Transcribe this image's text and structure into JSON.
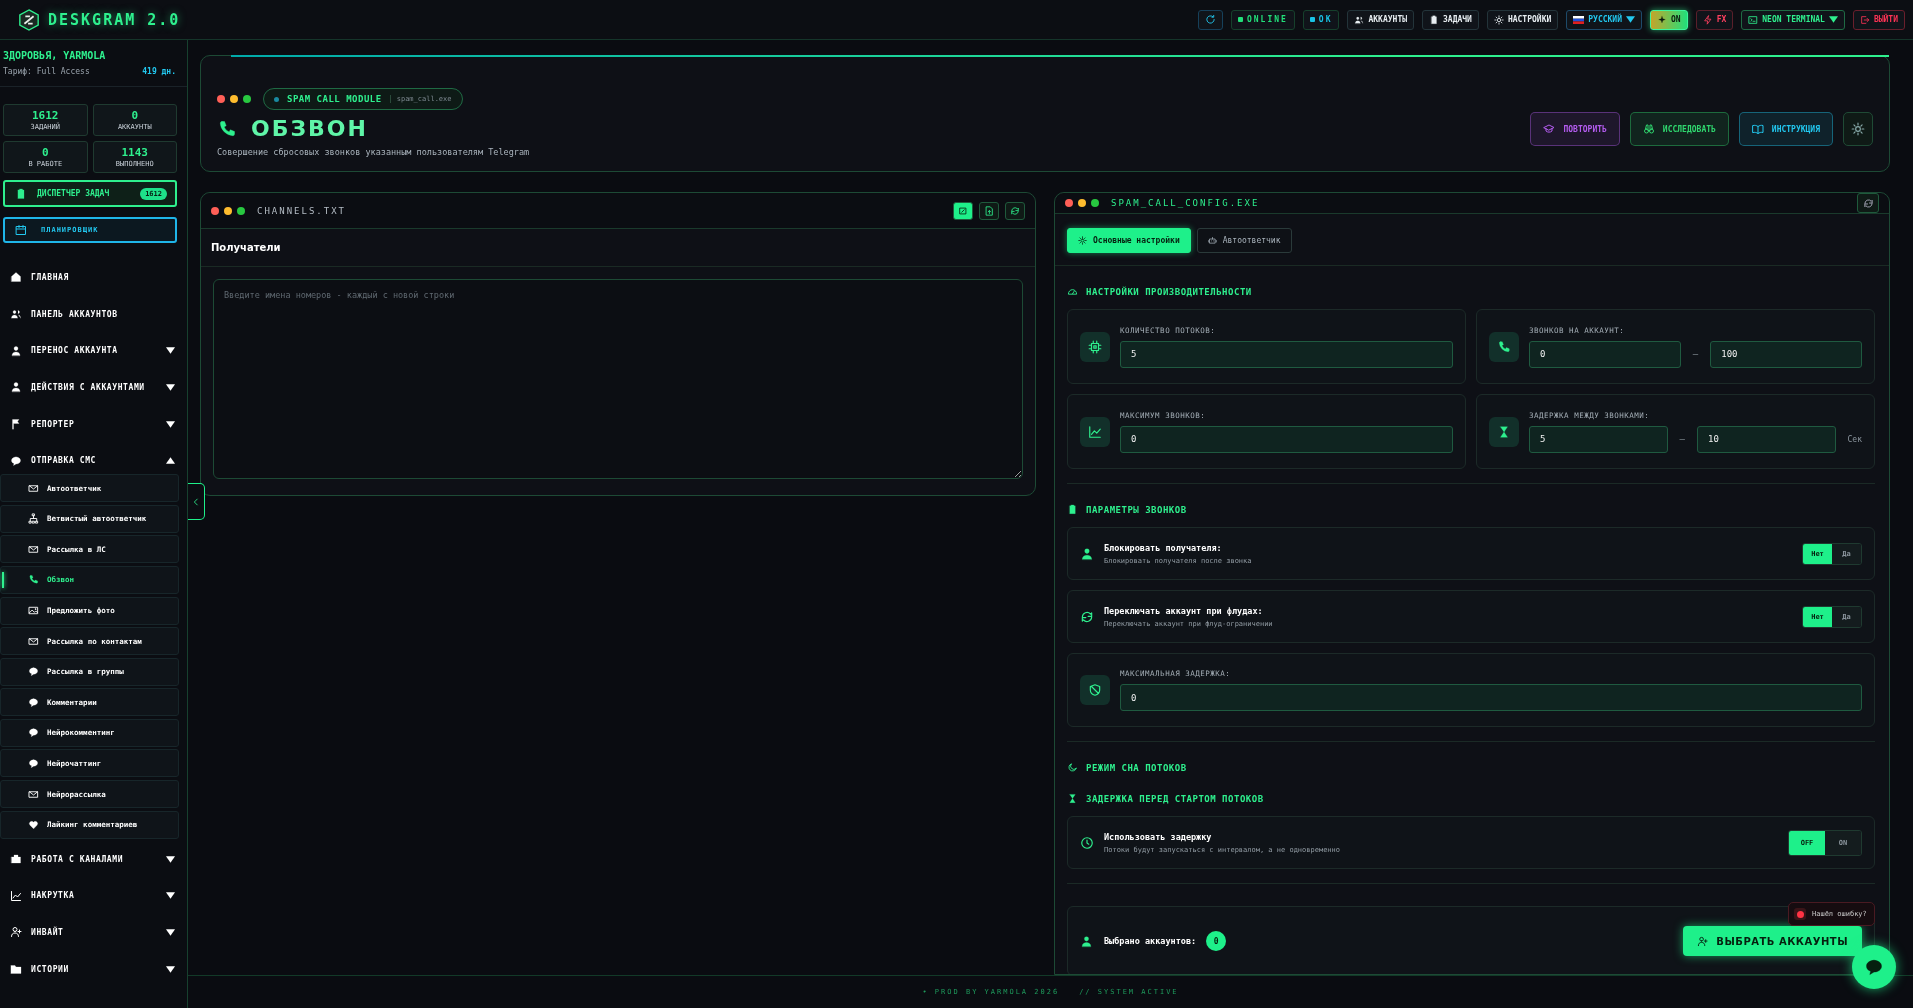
{
  "app": {
    "title": "DESKGRAM 2.0"
  },
  "topbar": {
    "items": [
      {
        "kind": "icon"
      },
      {
        "kind": "status",
        "label": "ONLINE",
        "color": "#22e07a"
      },
      {
        "kind": "status",
        "label": "OK",
        "color": "#19c3e6"
      },
      {
        "kind": "nav",
        "label": "АККАУНТЫ"
      },
      {
        "kind": "nav",
        "label": "ЗАДАЧИ"
      },
      {
        "kind": "nav",
        "label": "НАСТРОЙКИ"
      },
      {
        "kind": "select",
        "label": "РУССКИЙ"
      },
      {
        "kind": "toggle",
        "label": "ON"
      },
      {
        "kind": "effect",
        "label": "FX"
      },
      {
        "kind": "theme",
        "label": "NEON TERMINAL"
      },
      {
        "kind": "exit",
        "label": "ВЫЙТИ"
      }
    ]
  },
  "sidebar": {
    "greeting": "ЗДОРОВЬЯ, YARMOLA",
    "plan": "Тариф: Full Access",
    "days": "419 дн.",
    "stats": [
      {
        "value": "1612",
        "label": "ЗАДАНИЙ"
      },
      {
        "value": "0",
        "label": "АККАУНТЫ"
      },
      {
        "value": "0",
        "label": "В РАБОТЕ"
      },
      {
        "value": "1143",
        "label": "ВЫПОЛНЕНО"
      }
    ],
    "dispatcher": {
      "label": "ДИСПЕТЧЕР ЗАДАЧ",
      "badge": "1612"
    },
    "planner": {
      "label": "ПЛАНИРОВЩИК"
    },
    "items": [
      {
        "kind": "link",
        "label": "ГЛАВНАЯ"
      },
      {
        "kind": "link",
        "label": "ПАНЕЛЬ АККАУНТОВ"
      },
      {
        "kind": "group",
        "label": "ПЕРЕНОС АККАУНТА",
        "expanded": false
      },
      {
        "kind": "group",
        "label": "ДЕЙСТВИЯ С АККАУНТАМИ",
        "expanded": false
      },
      {
        "kind": "group",
        "label": "РЕПОРТЕР",
        "expanded": false
      },
      {
        "kind": "group",
        "label": "ОТПРАВКА СМС",
        "expanded": true,
        "children": [
          {
            "label": "Автоответчик",
            "selected": false
          },
          {
            "label": "Ветвистый автоответчик",
            "selected": false
          },
          {
            "label": "Рассылка в ЛС",
            "selected": false
          },
          {
            "label": "Обзвон",
            "selected": true
          },
          {
            "label": "Предложить фото",
            "selected": false
          },
          {
            "label": "Рассылка по контактам",
            "selected": false
          },
          {
            "label": "Рассылка в группы",
            "selected": false
          },
          {
            "label": "Комментарии",
            "selected": false
          },
          {
            "label": "Нейрокомментинг",
            "selected": false
          },
          {
            "label": "Нейрочаттинг",
            "selected": false
          },
          {
            "label": "Нейрорассылка",
            "selected": false
          },
          {
            "label": "Лайкинг комментариев",
            "selected": false
          }
        ]
      },
      {
        "kind": "group",
        "label": "РАБОТА С КАНАЛАМИ",
        "expanded": false
      },
      {
        "kind": "group",
        "label": "НАКРУТКА",
        "expanded": false
      },
      {
        "kind": "group",
        "label": "ИНВАЙТ",
        "expanded": false
      },
      {
        "kind": "group",
        "label": "ИСТОРИИ",
        "expanded": false
      }
    ]
  },
  "header": {
    "module": "SPAM CALL MODULE",
    "file": "spam_call.exe",
    "title": "ОБЗВОН",
    "subtitle": "Совершение сбросовых звонков указанным пользователям Telegram",
    "buttons": [
      {
        "label": "ПОВТОРИТЬ",
        "color": "#b45cf0"
      },
      {
        "label": "ИССЛЕДОВАТЬ",
        "color": "#2fd66e"
      },
      {
        "label": "ИНСТРУКЦИЯ",
        "color": "#22c8f0"
      }
    ]
  },
  "channels": {
    "title": "CHANNELS.TXT",
    "tools": [
      {
        "selected": true
      },
      {
        "selected": false
      },
      {
        "selected": false
      }
    ],
    "section": "Получатели",
    "placeholder": "Введите имена номеров - каждый с новой строки"
  },
  "config": {
    "title": "SPAM_CALL_CONFIG.EXE",
    "tabs": [
      {
        "label": "Основные настройки",
        "selected": true
      },
      {
        "label": "Автоответчик",
        "selected": false
      }
    ],
    "blocks": [
      {
        "kind": "heading",
        "label": "НАСТРОЙКИ ПРОИЗВОДИТЕЛЬНОСТИ"
      },
      {
        "kind": "fields",
        "fields": [
          {
            "label": "КОЛИЧЕСТВО ПОТОКОВ:",
            "values": [
              "5"
            ]
          },
          {
            "label": "ЗВОНКОВ НА АККАУНТ:",
            "values": [
              "0",
              "100"
            ],
            "separator": "—"
          },
          {
            "label": "МАКСИМУМ ЗВОНКОВ:",
            "values": [
              "0"
            ]
          },
          {
            "label": "ЗАДЕРЖКА МЕЖДУ ЗВОНКАМИ:",
            "values": [
              "5",
              "10"
            ],
            "separator": "—",
            "unit": "Сек"
          }
        ]
      },
      {
        "kind": "divider"
      },
      {
        "kind": "heading",
        "label": "ПАРАМЕТРЫ ЗВОНКОВ"
      },
      {
        "kind": "switch",
        "title": "Блокировать получателя:",
        "description": "Блокировать получателя после звонка",
        "options": [
          {
            "label": "Нет",
            "selected": true
          },
          {
            "label": "Да",
            "selected": false
          }
        ]
      },
      {
        "kind": "switch",
        "title": "Переключать аккаунт при флудах:",
        "description": "Переключать аккаунт при флуд-ограничении",
        "options": [
          {
            "label": "Нет",
            "selected": true
          },
          {
            "label": "Да",
            "selected": false
          }
        ]
      },
      {
        "kind": "wide-field",
        "label": "МАКСИМАЛЬНАЯ ЗАДЕРЖКА:",
        "value": "0"
      },
      {
        "kind": "divider"
      },
      {
        "kind": "heading",
        "label": "РЕЖИМ СНА ПОТОКОВ"
      },
      {
        "kind": "heading",
        "label": "ЗАДЕРЖКА ПЕРЕД СТАРТОМ ПОТОКОВ"
      },
      {
        "kind": "switch",
        "title": "Использовать задержку",
        "description": "Потоки будут запускаться с интервалом, а не одновременно",
        "options": [
          {
            "label": "OFF",
            "selected": true
          },
          {
            "label": "ON",
            "selected": false
          }
        ]
      },
      {
        "kind": "divider"
      }
    ],
    "selected_label": "Выбрано аккаунтов:",
    "selected_count": "0",
    "select_button": "ВЫБРАТЬ АККАУНТЫ"
  },
  "bug_report": "Нашёл ошибку?",
  "footer": {
    "credit": "• PROD BY YARMOLA 2026",
    "status": "// SYSTEM ACTIVE"
  }
}
